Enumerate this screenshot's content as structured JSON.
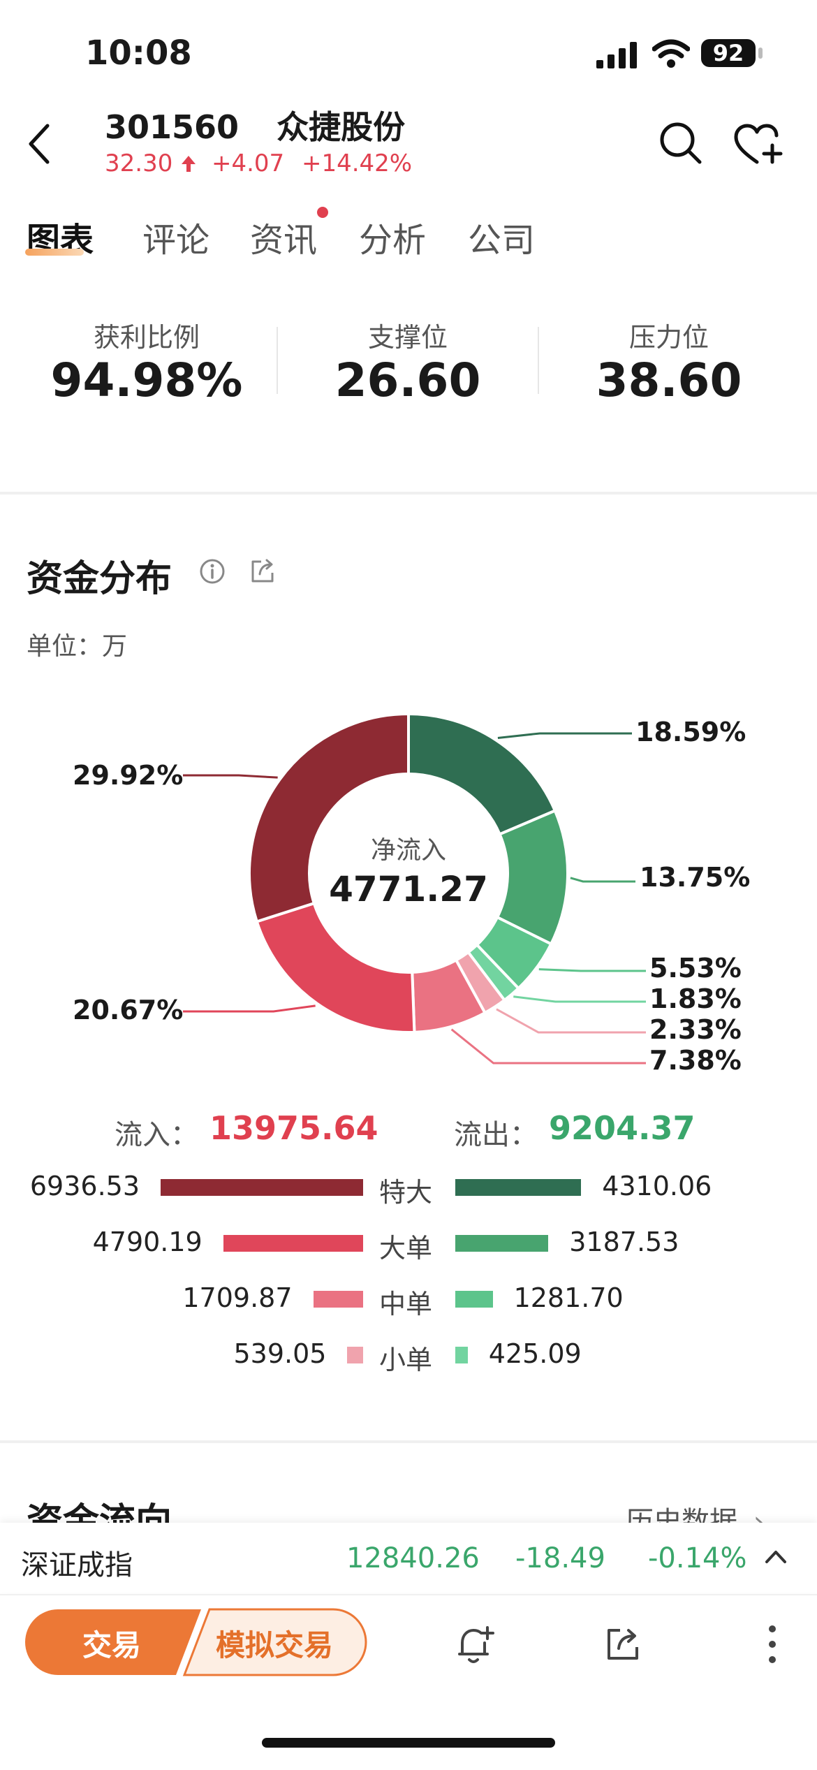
{
  "status_bar": {
    "time": "10:08",
    "battery": "92"
  },
  "header": {
    "code": "301560",
    "name": "众捷股份",
    "price": "32.30",
    "change": "+4.07",
    "change_pct": "+14.42%"
  },
  "tabs": [
    {
      "label": "图表",
      "active": true
    },
    {
      "label": "评论"
    },
    {
      "label": "资讯",
      "badge": true
    },
    {
      "label": "分析"
    },
    {
      "label": "公司"
    }
  ],
  "stats": [
    {
      "label": "获利比例",
      "value": "94.98%"
    },
    {
      "label": "支撑位",
      "value": "26.60"
    },
    {
      "label": "压力位",
      "value": "38.60"
    }
  ],
  "fund_dist": {
    "title": "资金分布",
    "unit": "单位：万",
    "center_label": "净流入",
    "center_value": "4771.27",
    "inflow_label": "流入：",
    "inflow_value": "13975.64",
    "outflow_label": "流出：",
    "outflow_value": "9204.37"
  },
  "chart_data": {
    "type": "pie",
    "slices": [
      {
        "label": "18.59%",
        "value": 18.59,
        "color": "#2f6e52"
      },
      {
        "label": "13.75%",
        "value": 13.75,
        "color": "#48a46f"
      },
      {
        "label": "5.53%",
        "value": 5.53,
        "color": "#5cc48b"
      },
      {
        "label": "1.83%",
        "value": 1.83,
        "color": "#72d4a0"
      },
      {
        "label": "2.33%",
        "value": 2.33,
        "color": "#f0a3ad"
      },
      {
        "label": "7.38%",
        "value": 7.38,
        "color": "#ea7282"
      },
      {
        "label": "20.67%",
        "value": 20.67,
        "color": "#e0465a"
      },
      {
        "label": "29.92%",
        "value": 29.92,
        "color": "#8e2a33"
      }
    ]
  },
  "orders": [
    {
      "label": "特大",
      "in": "6936.53",
      "out": "4310.06",
      "in_v": 6936.53,
      "out_v": 4310.06,
      "in_color": "#8e2a33",
      "out_color": "#2f6e52"
    },
    {
      "label": "大单",
      "in": "4790.19",
      "out": "3187.53",
      "in_v": 4790.19,
      "out_v": 3187.53,
      "in_color": "#e0465a",
      "out_color": "#48a46f"
    },
    {
      "label": "中单",
      "in": "1709.87",
      "out": "1281.70",
      "in_v": 1709.87,
      "out_v": 1281.7,
      "in_color": "#ea7282",
      "out_color": "#5cc48b"
    },
    {
      "label": "小单",
      "in": "539.05",
      "out": "425.09",
      "in_v": 539.05,
      "out_v": 425.09,
      "in_color": "#f0a3ad",
      "out_color": "#72d4a0"
    }
  ],
  "next_section": {
    "title": "资金流向",
    "history": "历史数据"
  },
  "index_strip": {
    "name": "深证成指",
    "value": "12840.26",
    "change": "-18.49",
    "change_pct": "-0.14%"
  },
  "bottom": {
    "trade": "交易",
    "sim_trade": "模拟交易"
  },
  "colors": {
    "up": "#e0404f",
    "down": "#3aa66b",
    "accent": "#ec7836"
  }
}
